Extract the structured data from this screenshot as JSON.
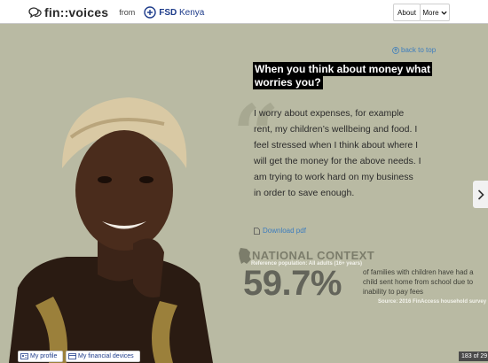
{
  "header": {
    "brand_name": "fin::voices",
    "from_label": "from",
    "partner": "FSD",
    "partner_suffix": "Kenya",
    "nav_about": "About",
    "nav_more": "More"
  },
  "content": {
    "back_to_top": "back to top",
    "question": "When you think about money what worries you?",
    "answer": "I worry about expenses, for example rent, my children’s wellbeing and food. I feel stressed when I think about where I will get the money for the above needs. I am trying to work hard on my business in order to save enough.",
    "download": "Download pdf"
  },
  "national_context": {
    "title": "NATIONAL CONTEXT",
    "reference": "Reference population: All adults (16+ years)",
    "percent": "59.7%",
    "description": "of families with children have had a child sent home from school due to inability to pay fees",
    "source": "Source: 2016 FinAccess household survey"
  },
  "footer": {
    "my_profile": "My profile",
    "my_devices": "My financial devices",
    "pager": "183 of 29"
  },
  "colors": {
    "background": "#b9baa3",
    "link": "#3d7dbd",
    "partner_blue": "#1d3b8a"
  },
  "icons": [
    "speech-bubbles-icon",
    "fsd-logo-icon",
    "chevron-down-icon",
    "arrow-up-circle-icon",
    "pdf-icon",
    "chevron-right-icon",
    "kenya-map-icon",
    "profile-card-icon",
    "devices-card-icon"
  ]
}
